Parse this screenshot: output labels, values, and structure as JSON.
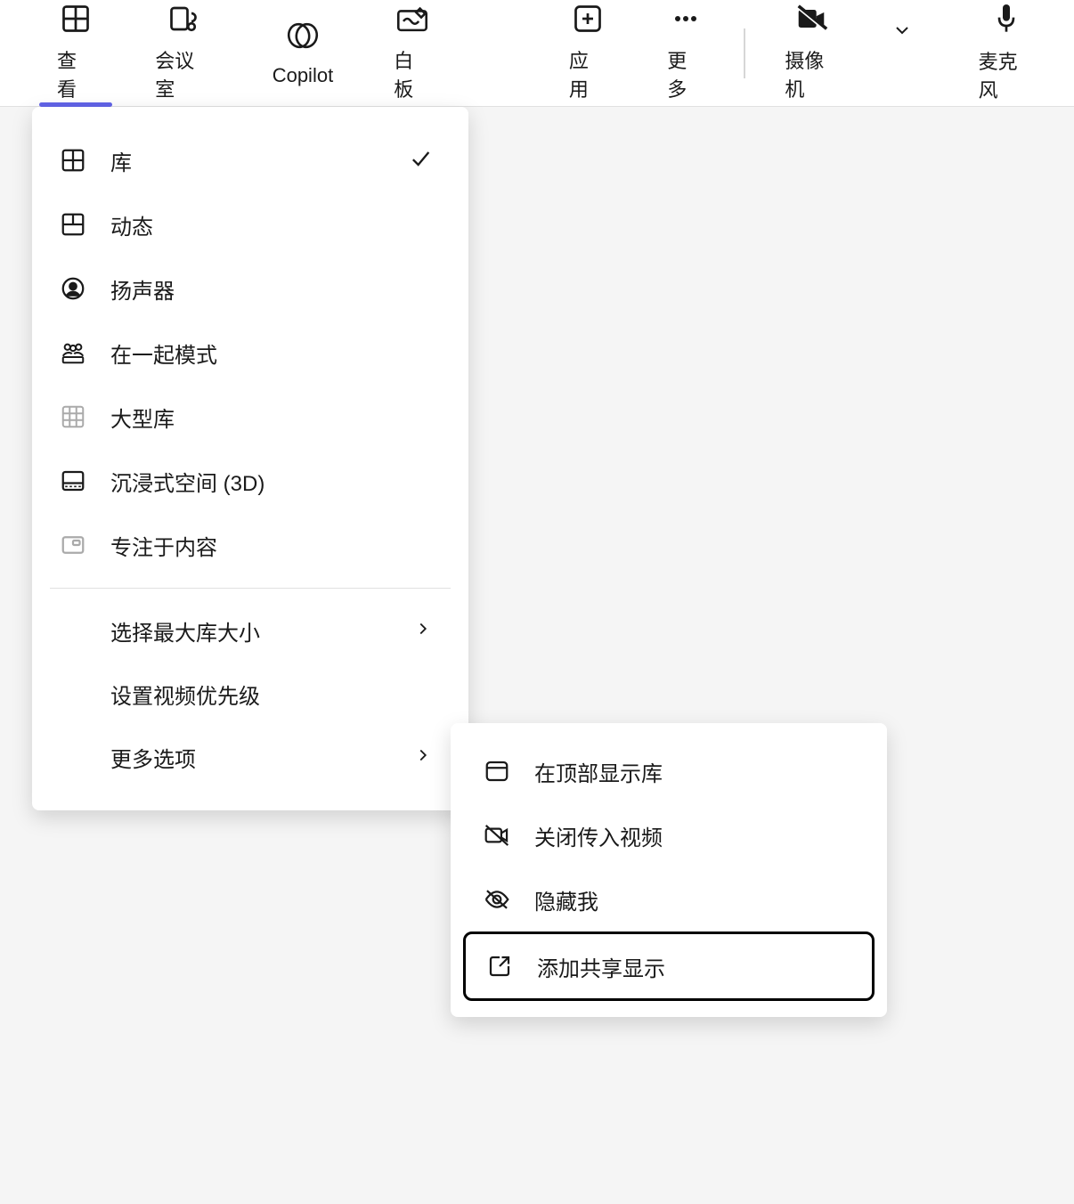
{
  "toolbar": {
    "view": "查看",
    "rooms": "会议室",
    "copilot": "Copilot",
    "whiteboard": "白板",
    "apps": "应用",
    "more": "更多",
    "camera": "摄像机",
    "microphone": "麦克风"
  },
  "viewMenu": {
    "gallery": "库",
    "dynamic": "动态",
    "speaker": "扬声器",
    "together": "在一起模式",
    "largeGallery": "大型库",
    "immersive": "沉浸式空间 (3D)",
    "focusContent": "专注于内容",
    "maxGallerySize": "选择最大库大小",
    "videoPriority": "设置视频优先级",
    "moreOptions": "更多选项"
  },
  "submenu": {
    "showTopGallery": "在顶部显示库",
    "turnOffIncomingVideo": "关闭传入视频",
    "hideMe": "隐藏我",
    "addSharedDisplay": "添加共享显示"
  }
}
